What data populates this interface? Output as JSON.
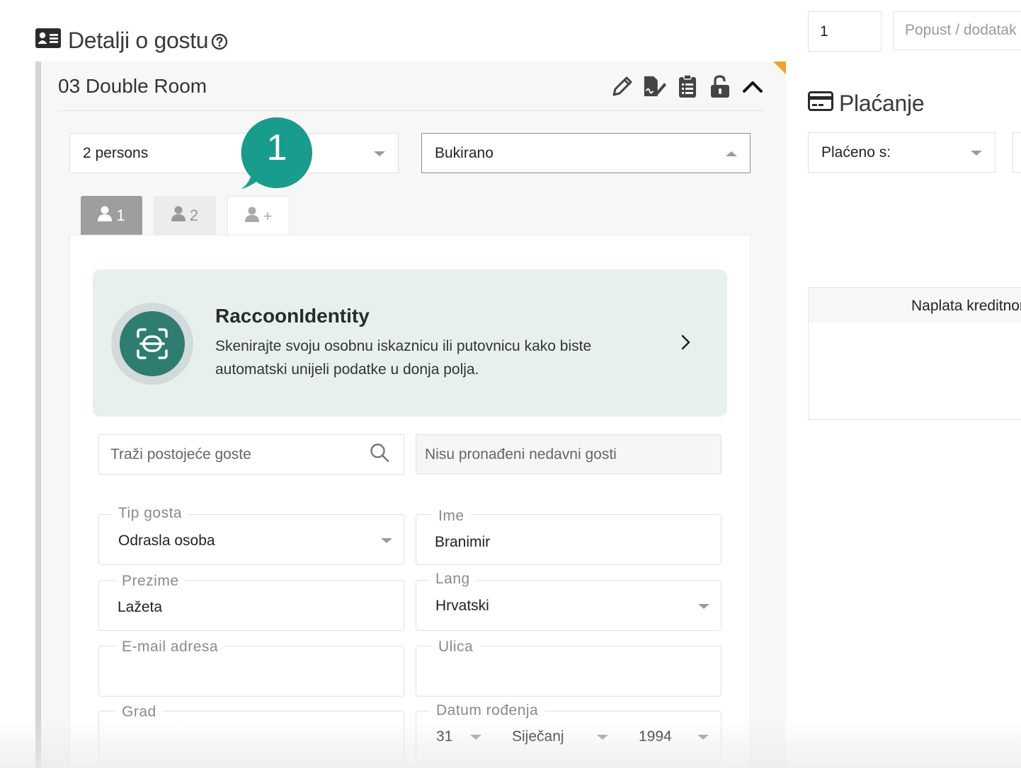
{
  "guest_details": {
    "title": "Detalji o gostu",
    "help_icon": "question-circle-icon",
    "header_icon": "id-card-icon"
  },
  "room": {
    "title": "03 Double Room",
    "tools": [
      "pencil-icon",
      "signature-icon",
      "clipboard-icon",
      "unlock-icon",
      "chevron-up-icon"
    ],
    "persons_select": "2 persons",
    "status_select": "Bukirano"
  },
  "tour_badge": {
    "number": "1",
    "color": "#199c8c"
  },
  "guest_tabs": [
    {
      "label": "1",
      "state": "active"
    },
    {
      "label": "2",
      "state": "inactive"
    },
    {
      "label": "+",
      "state": "add"
    }
  ],
  "raccoon_identity": {
    "name": "RaccoonIdentity",
    "description": "Skenirajte svoju osobnu iskaznicu ili putovnicu kako biste automatski unijeli podatke u donja polja.",
    "accent_color": "#2e7d70"
  },
  "search": {
    "placeholder": "Traži postojeće goste",
    "recent": "Nisu pronađeni nedavni gosti"
  },
  "form": {
    "guest_type": {
      "label": "Tip gosta",
      "value": "Odrasla osoba"
    },
    "first_name": {
      "label": "Ime",
      "value": "Branimir"
    },
    "last_name": {
      "label": "Prezime",
      "value": "Lažeta"
    },
    "language": {
      "label": "Lang",
      "value": "Hrvatski"
    },
    "email": {
      "label": "E-mail adresa",
      "value": ""
    },
    "street": {
      "label": "Ulica",
      "value": ""
    },
    "city": {
      "label": "Grad",
      "value": ""
    },
    "dob": {
      "label": "Datum rođenja",
      "day": "31",
      "month": "Siječanj",
      "year": "1994"
    }
  },
  "right_panel": {
    "quantity": "1",
    "discount_placeholder": "Popust / dodatak",
    "payment_title": "Plaćanje",
    "payment_icon": "credit-card-icon",
    "paid_with": "Plaćeno s:",
    "card_charge": "Naplata kreditnom karticom"
  }
}
